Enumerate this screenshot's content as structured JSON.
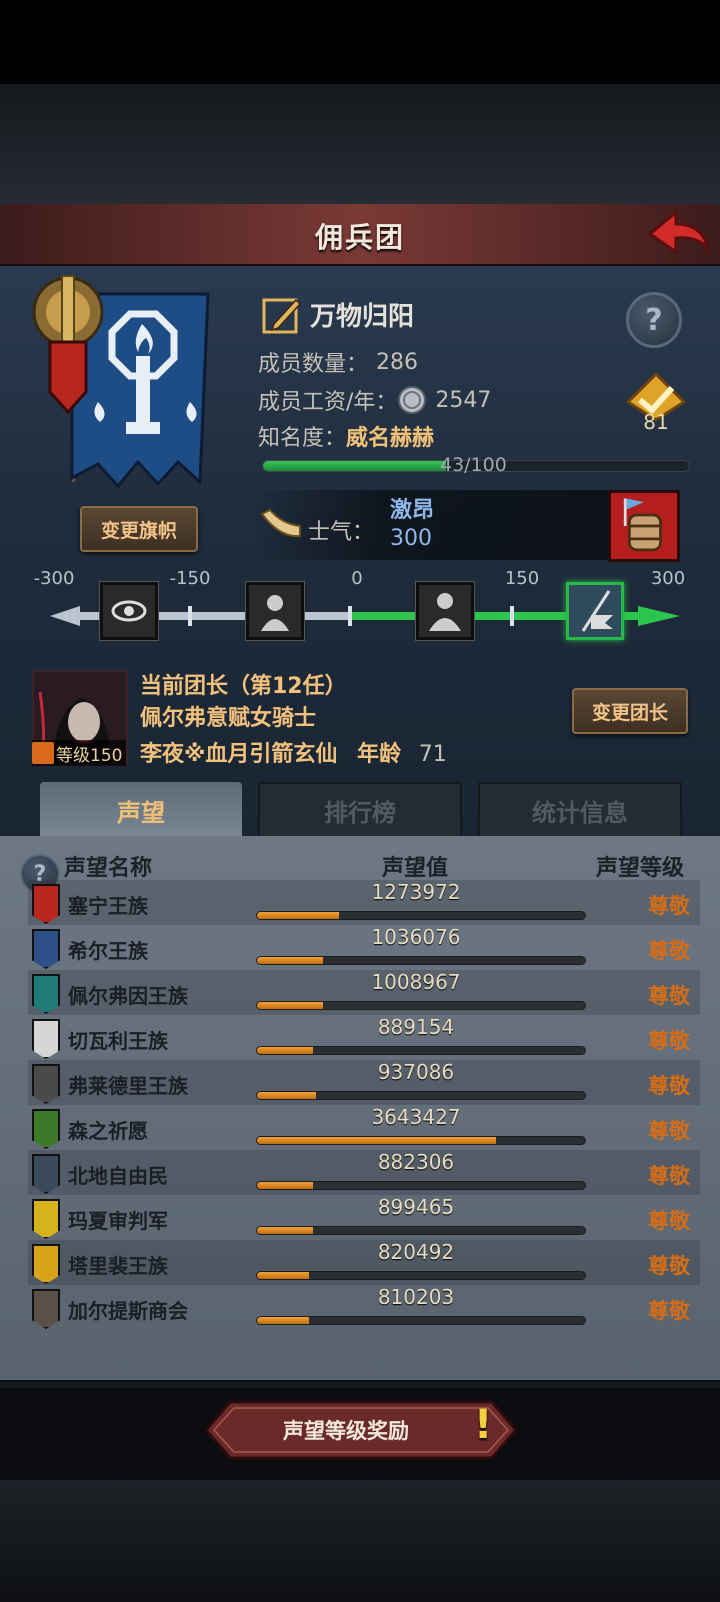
{
  "header": {
    "title": "佣兵团"
  },
  "guild": {
    "name": "万物归阳",
    "members_label": "成员数量：",
    "members_value": "286",
    "salary_label": "成员工资/年：",
    "salary_value": "2547",
    "fame_label": "知名度：",
    "fame_value": "威名赫赫",
    "fame_progress_text": "43/100",
    "fame_progress": 0.43,
    "rank_badge_value": "81",
    "change_flag_label": "变更旗帜",
    "morale_label": "士气：",
    "morale_status": "激昂",
    "morale_value": "300"
  },
  "morale_scale": {
    "labels": [
      "-300",
      "-150",
      "0",
      "150",
      "300"
    ],
    "current": 300
  },
  "leader": {
    "title": "当前团长（第12任）",
    "class_name": "佩尔弗意赋女骑士",
    "player_name": "李夜※血月引箭玄仙",
    "age_label": "年龄",
    "age_value": "71",
    "level_text": "等级150",
    "change_label": "变更团长"
  },
  "tabs": [
    {
      "label": "声望",
      "active": true
    },
    {
      "label": "排行榜",
      "active": false
    },
    {
      "label": "统计信息",
      "active": false
    }
  ],
  "reputation": {
    "headers": {
      "name": "声望名称",
      "value": "声望值",
      "level": "声望等级"
    },
    "rows": [
      {
        "name": "塞宁王族",
        "value": "1273972",
        "level": "尊敬",
        "progress": 0.25,
        "color": "#b8261e"
      },
      {
        "name": "希尔王族",
        "value": "1036076",
        "level": "尊敬",
        "progress": 0.2,
        "color": "#2c4f86"
      },
      {
        "name": "佩尔弗因王族",
        "value": "1008967",
        "level": "尊敬",
        "progress": 0.2,
        "color": "#1f7a78"
      },
      {
        "name": "切瓦利王族",
        "value": "889154",
        "level": "尊敬",
        "progress": 0.17,
        "color": "#d6d6d6"
      },
      {
        "name": "弗莱德里王族",
        "value": "937086",
        "level": "尊敬",
        "progress": 0.18,
        "color": "#4a4a4a"
      },
      {
        "name": "森之祈愿",
        "value": "3643427",
        "level": "尊敬",
        "progress": 0.73,
        "color": "#3c7a2a"
      },
      {
        "name": "北地自由民",
        "value": "882306",
        "level": "尊敬",
        "progress": 0.17,
        "color": "#3a4a5a"
      },
      {
        "name": "玛夏审判军",
        "value": "899465",
        "level": "尊敬",
        "progress": 0.17,
        "color": "#d6b21c"
      },
      {
        "name": "塔里裴王族",
        "value": "820492",
        "level": "尊敬",
        "progress": 0.16,
        "color": "#d8a41a"
      },
      {
        "name": "加尔提斯商会",
        "value": "810203",
        "level": "尊敬",
        "progress": 0.16,
        "color": "#5a5048"
      }
    ]
  },
  "footer": {
    "reward_label": "声望等级奖励"
  }
}
